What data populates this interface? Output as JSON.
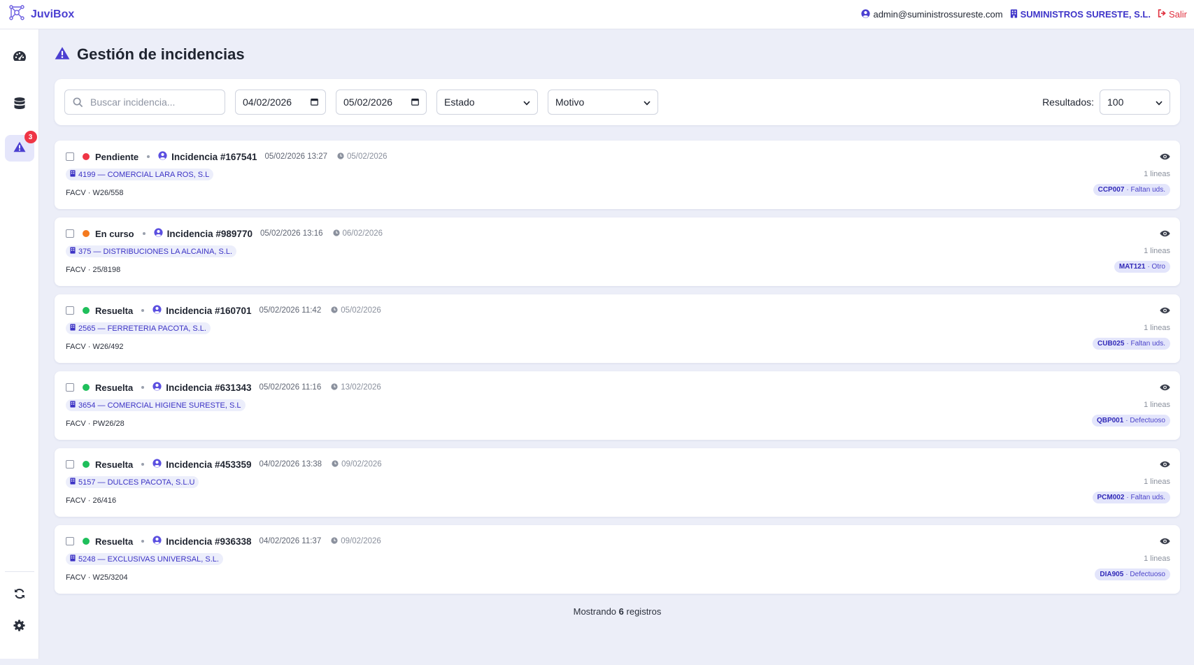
{
  "app": {
    "name": "JuviBox",
    "logo_icon": "network-logo-icon",
    "accent": "#4b3fd1"
  },
  "topbar": {
    "user_email": "admin@suministrossureste.com",
    "company": "SUMINISTROS SURESTE, S.L.",
    "logout_label": "Salir"
  },
  "sidebar": {
    "items": [
      {
        "icon": "dashboard-gauge-icon"
      },
      {
        "icon": "database-icon"
      },
      {
        "icon": "warning-triangle-icon",
        "badge": "3",
        "active": true
      }
    ],
    "bottom_items": [
      {
        "icon": "refresh-icon"
      },
      {
        "icon": "gear-icon"
      }
    ]
  },
  "page": {
    "title": "Gestión de incidencias",
    "title_icon": "warning-triangle-icon"
  },
  "filters": {
    "search_placeholder": "Buscar incidencia...",
    "date_from": "04/02/2026",
    "date_to": "05/02/2026",
    "estado": "Estado",
    "motivo": "Motivo",
    "results_label": "Resultados:",
    "results_value": "100"
  },
  "incidents": [
    {
      "status": "Pendiente",
      "status_color": "#ef3545",
      "title": "Incidencia #167541",
      "date": "05/02/2026 13:27",
      "due": "05/02/2026",
      "client": "4199 — COMERCIAL LARA ROS, S.L",
      "doc": "FACV · W26/558",
      "lines": "1 lineas",
      "product_code": "CCP007",
      "product_reason": "· Faltan uds."
    },
    {
      "status": "En curso",
      "status_color": "#f47a1f",
      "title": "Incidencia #989770",
      "date": "05/02/2026 13:16",
      "due": "06/02/2026",
      "client": "375 — DISTRIBUCIONES LA ALCAINA, S.L.",
      "doc": "FACV · 25/8198",
      "lines": "1 lineas",
      "product_code": "MAT121",
      "product_reason": "· Otro"
    },
    {
      "status": "Resuelta",
      "status_color": "#1fbf5b",
      "title": "Incidencia #160701",
      "date": "05/02/2026 11:42",
      "due": "05/02/2026",
      "client": "2565 — FERRETERIA PACOTA, S.L.",
      "doc": "FACV · W26/492",
      "lines": "1 lineas",
      "product_code": "CUB025",
      "product_reason": "· Faltan uds."
    },
    {
      "status": "Resuelta",
      "status_color": "#1fbf5b",
      "title": "Incidencia #631343",
      "date": "05/02/2026 11:16",
      "due": "13/02/2026",
      "client": "3654 — COMERCIAL HIGIENE SURESTE, S.L",
      "doc": "FACV · PW26/28",
      "lines": "1 lineas",
      "product_code": "QBP001",
      "product_reason": "· Defectuoso"
    },
    {
      "status": "Resuelta",
      "status_color": "#1fbf5b",
      "title": "Incidencia #453359",
      "date": "04/02/2026 13:38",
      "due": "09/02/2026",
      "client": "5157 — DULCES PACOTA, S.L.U",
      "doc": "FACV · 26/416",
      "lines": "1 lineas",
      "product_code": "PCM002",
      "product_reason": "· Faltan uds."
    },
    {
      "status": "Resuelta",
      "status_color": "#1fbf5b",
      "title": "Incidencia #936338",
      "date": "04/02/2026 11:37",
      "due": "09/02/2026",
      "client": "5248 — EXCLUSIVAS UNIVERSAL, S.L.",
      "doc": "FACV · W25/3204",
      "lines": "1 lineas",
      "product_code": "DIA905",
      "product_reason": "· Defectuoso"
    }
  ],
  "footer": {
    "prefix": "Mostrando",
    "count": "6",
    "suffix": "registros"
  }
}
